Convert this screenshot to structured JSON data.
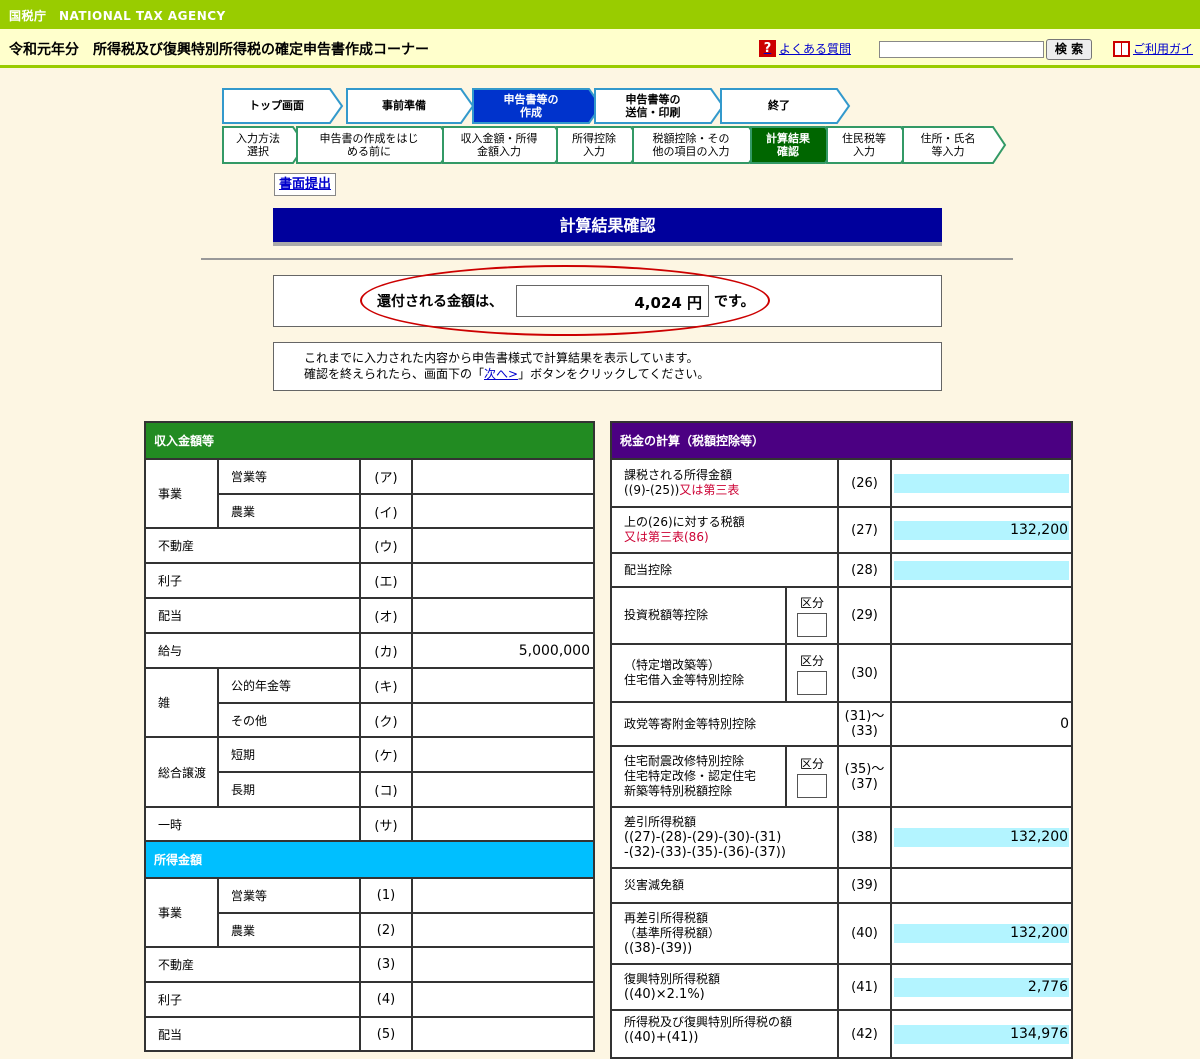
{
  "header": {
    "agency": "国税庁　NATIONAL TAX AGENCY",
    "title": "令和元年分　所得税及び復興特別所得税の確定申告書作成コーナー",
    "faq_link": "よくある質問",
    "search_button": "検 索",
    "guide_link": "ご利用ガイ"
  },
  "steps_main": [
    {
      "label": "トップ画面"
    },
    {
      "label": "事前準備"
    },
    {
      "label": "申告書等の\n作成"
    },
    {
      "label": "申告書等の\n送信・印刷"
    },
    {
      "label": "終了"
    }
  ],
  "steps_sub": [
    {
      "label": "入力方法\n選択"
    },
    {
      "label": "申告書の作成をはじ\nめる前に"
    },
    {
      "label": "収入金額・所得\n金額入力"
    },
    {
      "label": "所得控除\n入力"
    },
    {
      "label": "税額控除・その\n他の項目の入力"
    },
    {
      "label": "計算結果\n確認"
    },
    {
      "label": "住民税等\n入力"
    },
    {
      "label": "住所・氏名\n等入力"
    }
  ],
  "submit_link": "書面提出",
  "page_title": "計算結果確認",
  "refund": {
    "prefix": "還付される金額は、",
    "amount": "4,024 円",
    "suffix": "です。"
  },
  "info": {
    "line1": "これまでに入力された内容から申告書様式で計算結果を表示しています。",
    "line2_pre": "確認を終えられたら、画面下の「",
    "line2_link": "次へ>",
    "line2_post": "」ボタンをクリックしてください。"
  },
  "income": {
    "section_title": "収入金額等",
    "business": "事業",
    "business_sales": "営業等",
    "business_sales_code": "(ア)",
    "business_farm": "農業",
    "business_farm_code": "(イ)",
    "realestate": "不動産",
    "realestate_code": "(ウ)",
    "interest": "利子",
    "interest_code": "(エ)",
    "dividend": "配当",
    "dividend_code": "(オ)",
    "salary": "給与",
    "salary_code": "(カ)",
    "salary_value": "5,000,000",
    "misc": "雑",
    "misc_pension": "公的年金等",
    "misc_pension_code": "(キ)",
    "misc_other": "その他",
    "misc_other_code": "(ク)",
    "transfer": "総合譲渡",
    "transfer_short": "短期",
    "transfer_short_code": "(ケ)",
    "transfer_long": "長期",
    "transfer_long_code": "(コ)",
    "temporary": "一時",
    "temporary_code": "(サ)"
  },
  "shotoku": {
    "section_title": "所得金額",
    "business": "事業",
    "business_sales": "営業等",
    "business_sales_code": "(1)",
    "business_farm": "農業",
    "business_farm_code": "(2)",
    "realestate": "不動産",
    "realestate_code": "(3)",
    "interest": "利子",
    "interest_code": "(4)",
    "dividend": "配当",
    "dividend_code": "(5)"
  },
  "tax": {
    "section_title": "税金の計算（税額控除等）",
    "kubun": "区分",
    "r26_l1": "課税される所得金額",
    "r26_l2": "((9)-(25))",
    "r26_l2_red": "又は第三表",
    "r26_code": "(26)",
    "r27_l1": "上の(26)に対する税額",
    "r27_l2_red": "又は第三表(86)",
    "r27_code": "(27)",
    "r27_value": "132,200",
    "r28_l1": "配当控除",
    "r28_code": "(28)",
    "r29_l1": "投資税額等控除",
    "r29_code": "(29)",
    "r30_l1": "（特定増改築等）",
    "r30_l2": "住宅借入金等特別控除",
    "r30_code": "(30)",
    "r31_l1": "政党等寄附金等特別控除",
    "r31_code": "(31)～\n(33)",
    "r31_value": "0",
    "r35_l1": "住宅耐震改修特別控除",
    "r35_l2": "住宅特定改修・認定住宅",
    "r35_l3": "新築等特別税額控除",
    "r35_code": "(35)～\n(37)",
    "r38_l1": "差引所得税額",
    "r38_l2": "((27)-(28)-(29)-(30)-(31)",
    "r38_l3": "-(32)-(33)-(35)-(36)-(37))",
    "r38_code": "(38)",
    "r38_value": "132,200",
    "r39_l1": "災害減免額",
    "r39_code": "(39)",
    "r40_l1": "再差引所得税額",
    "r40_l2": "（基準所得税額）",
    "r40_l3": "((38)-(39))",
    "r40_code": "(40)",
    "r40_value": "132,200",
    "r41_l1": "復興特別所得税額",
    "r41_l2": "((40)×2.1%)",
    "r41_code": "(41)",
    "r41_value": "2,776",
    "r42_l1": "所得税及び復興特別所得税の額",
    "r42_l2": "((40)+(41))",
    "r42_code": "(42)",
    "r42_value": "134,976"
  },
  "colors": {
    "agency_bar": "#99cc00",
    "title_bar": "#ffffcc",
    "page_head": "#00009c",
    "income_section": "#228b22",
    "shotoku_section": "#00bfff",
    "tax_section": "#4b0082",
    "computed_cell": "#b3f4ff",
    "refund_oval": "#cc0000"
  }
}
